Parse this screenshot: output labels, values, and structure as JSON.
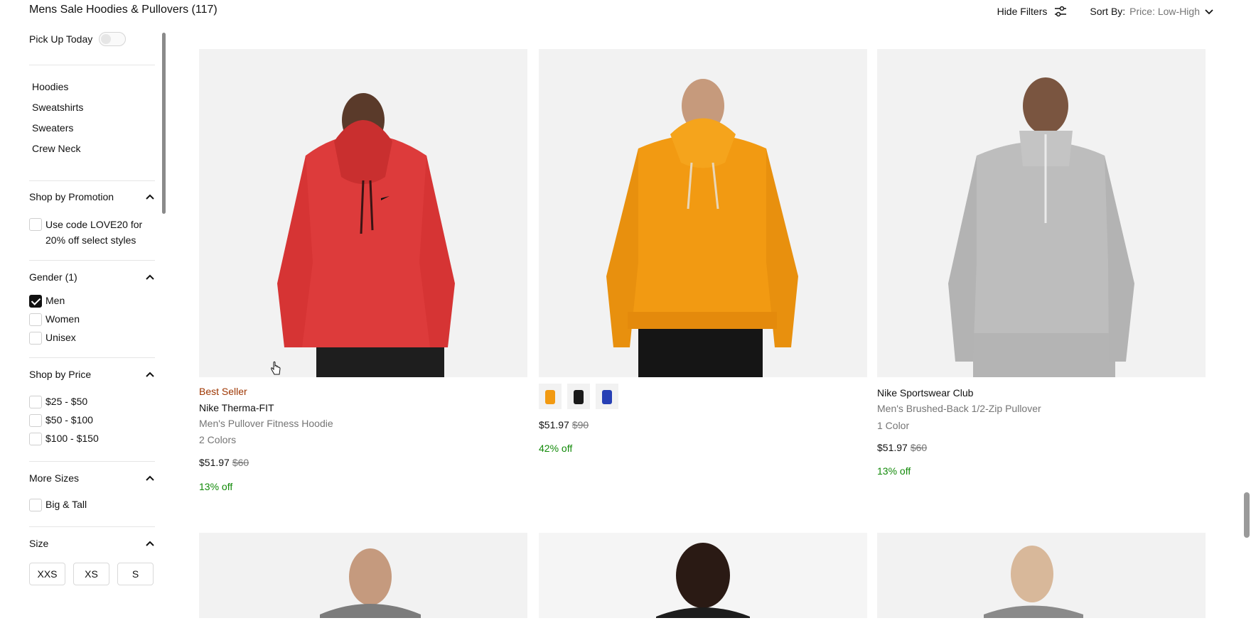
{
  "header": {
    "title": "Mens Sale Hoodies & Pullovers (117)",
    "hide_filters": "Hide Filters",
    "sort_label": "Sort By:",
    "sort_value": "Price: Low-High"
  },
  "sidebar": {
    "pickup_label": "Pick Up Today",
    "pickup_on": false,
    "categories": [
      "Hoodies",
      "Sweatshirts",
      "Sweaters",
      "Crew Neck"
    ],
    "promotion": {
      "heading": "Shop by Promotion",
      "options": [
        {
          "label": "Use code LOVE20 for 20% off select styles",
          "checked": false
        }
      ]
    },
    "gender": {
      "heading": "Gender (1)",
      "options": [
        {
          "label": "Men",
          "checked": true
        },
        {
          "label": "Women",
          "checked": false
        },
        {
          "label": "Unisex",
          "checked": false
        }
      ]
    },
    "price": {
      "heading": "Shop by Price",
      "options": [
        {
          "label": "$25 - $50",
          "checked": false
        },
        {
          "label": "$50 - $100",
          "checked": false
        },
        {
          "label": "$100 - $150",
          "checked": false
        }
      ]
    },
    "more_sizes": {
      "heading": "More Sizes",
      "options": [
        {
          "label": "Big & Tall",
          "checked": false
        }
      ]
    },
    "size": {
      "heading": "Size",
      "options": [
        "XXS",
        "XS",
        "S"
      ]
    }
  },
  "products": [
    {
      "badge": "Best Seller",
      "name": "Nike Therma-FIT",
      "subtitle": "Men's Pullover Fitness Hoodie",
      "colors": "2 Colors",
      "price": "$51.97",
      "original_price": "$60",
      "discount": "13% off",
      "hoodie_color": "#dd3b3b"
    },
    {
      "price": "$51.97",
      "original_price": "$90",
      "discount": "42% off",
      "hoodie_color": "#f29a12",
      "swatches": [
        "#f29a12",
        "#1a1a1a",
        "#2740b5"
      ]
    },
    {
      "name": "Nike Sportswear Club",
      "subtitle": "Men's Brushed-Back 1/2-Zip Pullover",
      "colors": "1 Color",
      "price": "$51.97",
      "original_price": "$60",
      "discount": "13% off",
      "hoodie_color": "#bdbdbd"
    }
  ]
}
